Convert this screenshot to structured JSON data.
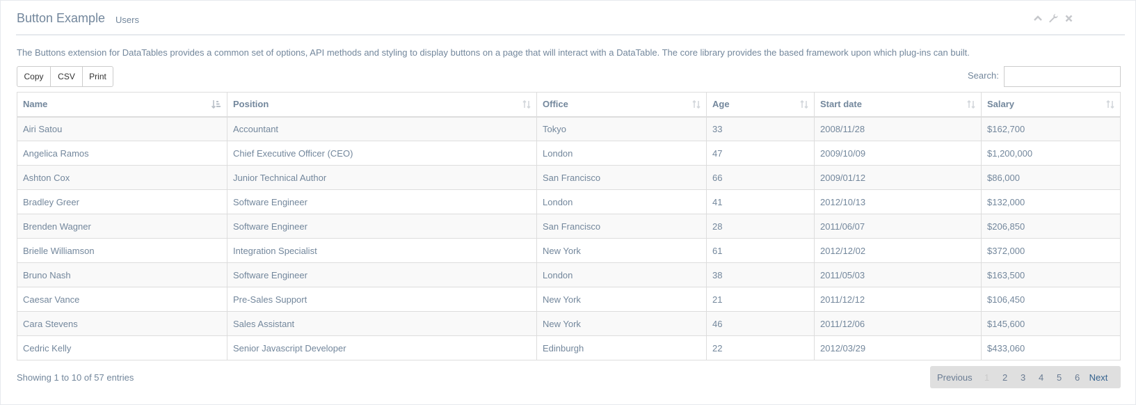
{
  "panel": {
    "title": "Button Example",
    "subtitle": "Users",
    "tools": [
      "chevron-up-icon",
      "wrench-icon",
      "close-icon"
    ]
  },
  "description": "The Buttons extension for DataTables provides a common set of options, API methods and styling to display buttons on a page that will interact with a DataTable. The core library provides the based framework upon which plug-ins can built.",
  "buttons": {
    "copy": "Copy",
    "csv": "CSV",
    "print": "Print"
  },
  "search": {
    "label": "Search:",
    "value": "",
    "placeholder": ""
  },
  "table": {
    "columns": [
      "Name",
      "Position",
      "Office",
      "Age",
      "Start date",
      "Salary"
    ],
    "sorted_column": "Name",
    "sort_direction": "ascending",
    "rows": [
      [
        "Airi Satou",
        "Accountant",
        "Tokyo",
        "33",
        "2008/11/28",
        "$162,700"
      ],
      [
        "Angelica Ramos",
        "Chief Executive Officer (CEO)",
        "London",
        "47",
        "2009/10/09",
        "$1,200,000"
      ],
      [
        "Ashton Cox",
        "Junior Technical Author",
        "San Francisco",
        "66",
        "2009/01/12",
        "$86,000"
      ],
      [
        "Bradley Greer",
        "Software Engineer",
        "London",
        "41",
        "2012/10/13",
        "$132,000"
      ],
      [
        "Brenden Wagner",
        "Software Engineer",
        "San Francisco",
        "28",
        "2011/06/07",
        "$206,850"
      ],
      [
        "Brielle Williamson",
        "Integration Specialist",
        "New York",
        "61",
        "2012/12/02",
        "$372,000"
      ],
      [
        "Bruno Nash",
        "Software Engineer",
        "London",
        "38",
        "2011/05/03",
        "$163,500"
      ],
      [
        "Caesar Vance",
        "Pre-Sales Support",
        "New York",
        "21",
        "2011/12/12",
        "$106,450"
      ],
      [
        "Cara Stevens",
        "Sales Assistant",
        "New York",
        "46",
        "2011/12/06",
        "$145,600"
      ],
      [
        "Cedric Kelly",
        "Senior Javascript Developer",
        "Edinburgh",
        "22",
        "2012/03/29",
        "$433,060"
      ]
    ]
  },
  "info": "Showing 1 to 10 of 57 entries",
  "pagination": {
    "previous": "Previous",
    "pages": [
      "1",
      "2",
      "3",
      "4",
      "5",
      "6"
    ],
    "current": "1",
    "next": "Next"
  },
  "colors": {
    "text": "#73879C",
    "border": "#dddddd",
    "stripe": "#f9f9f9",
    "pager_bg": "#dfdfdf",
    "next_link": "#35638f"
  }
}
